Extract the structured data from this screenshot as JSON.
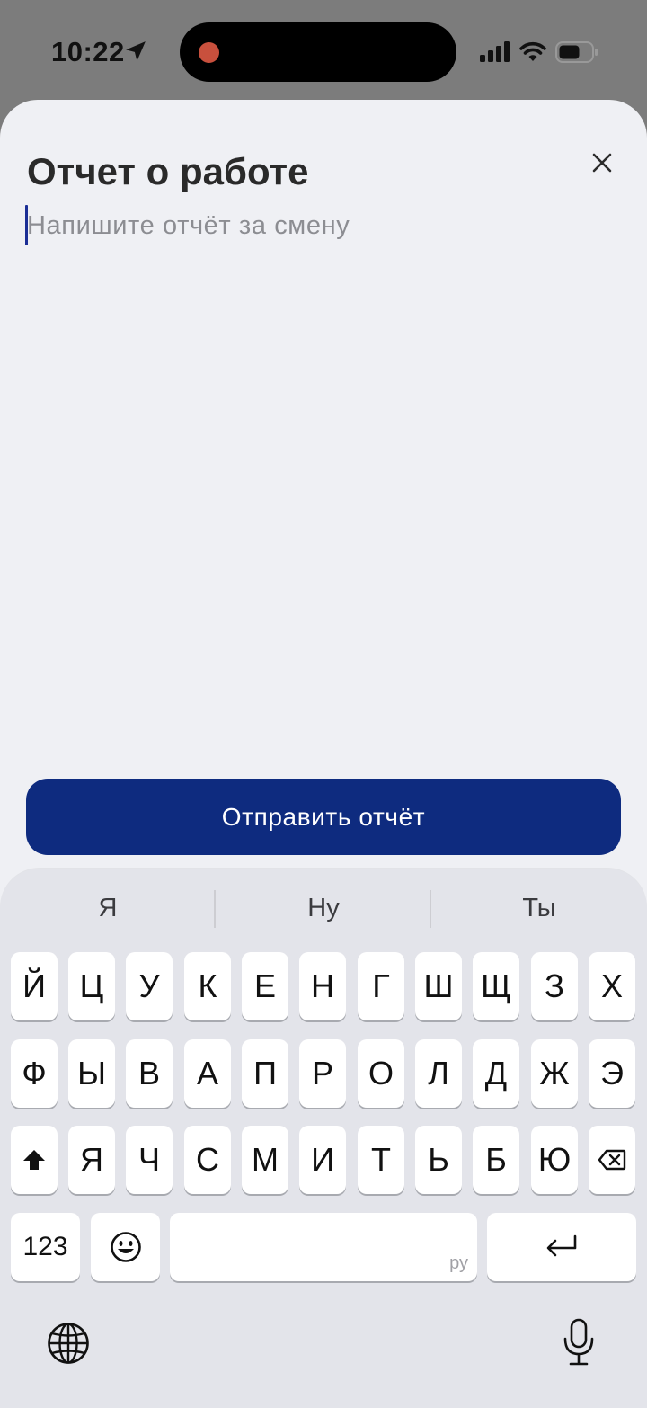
{
  "status_bar": {
    "time": "10:22",
    "icons": [
      "location-arrow-icon",
      "signal-bars-icon",
      "wifi-icon",
      "battery-icon"
    ],
    "recording_indicator_color": "#c8503d"
  },
  "sheet": {
    "title": "Отчет о работе",
    "close_icon": "close-icon",
    "input_placeholder": "Напишите отчёт за смену",
    "input_value": "",
    "submit_label": "Отправить отчёт",
    "accent_color": "#0e2b7f"
  },
  "keyboard": {
    "suggestions": [
      "Я",
      "Ну",
      "Ты"
    ],
    "row1": [
      "Й",
      "Ц",
      "У",
      "К",
      "Е",
      "Н",
      "Г",
      "Ш",
      "Щ",
      "З",
      "Х"
    ],
    "row2": [
      "Ф",
      "Ы",
      "В",
      "А",
      "П",
      "Р",
      "О",
      "Л",
      "Д",
      "Ж",
      "Э"
    ],
    "row3": [
      "Я",
      "Ч",
      "С",
      "М",
      "И",
      "Т",
      "Ь",
      "Б",
      "Ю"
    ],
    "numbers_label": "123",
    "space_language": "ру",
    "icons": [
      "shift-icon",
      "backspace-icon",
      "emoji-icon",
      "return-icon",
      "globe-icon",
      "microphone-icon"
    ]
  }
}
